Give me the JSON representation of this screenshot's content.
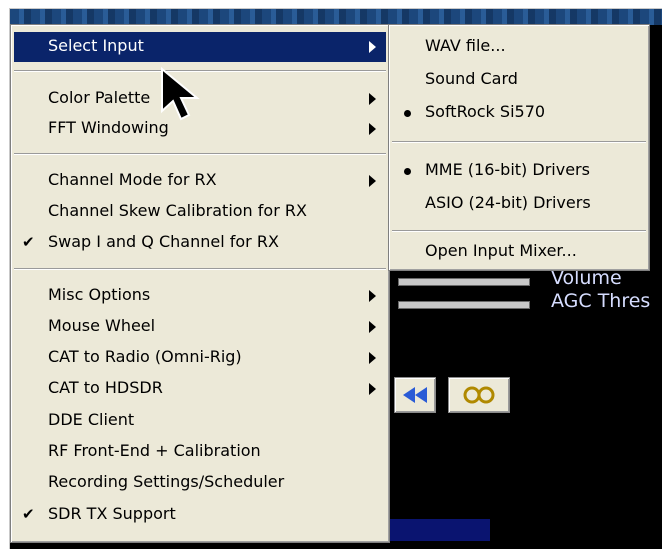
{
  "background": {
    "labels": {
      "volume": "Volume",
      "agc": "AGC Thres"
    }
  },
  "main_menu": {
    "items": [
      {
        "label": "Select Input",
        "has_submenu": true,
        "highlighted": true
      },
      {
        "label": "Color Palette",
        "has_submenu": true
      },
      {
        "label": "FFT Windowing",
        "has_submenu": true
      },
      {
        "label": "Channel Mode for RX",
        "has_submenu": true
      },
      {
        "label": "Channel Skew Calibration for RX"
      },
      {
        "label": "Swap I and Q Channel for RX",
        "checked": true
      },
      {
        "label": "Misc Options",
        "has_submenu": true
      },
      {
        "label": "Mouse Wheel",
        "has_submenu": true
      },
      {
        "label": "CAT to Radio (Omni-Rig)",
        "has_submenu": true
      },
      {
        "label": "CAT to HDSDR",
        "has_submenu": true
      },
      {
        "label": "DDE Client"
      },
      {
        "label": "RF Front-End + Calibration"
      },
      {
        "label": "Recording Settings/Scheduler"
      },
      {
        "label": "SDR TX Support",
        "checked": true
      }
    ]
  },
  "submenu": {
    "items": [
      {
        "label": "WAV file..."
      },
      {
        "label": "Sound Card"
      },
      {
        "label": "SoftRock Si570",
        "selected": true
      },
      {
        "label": "MME  (16-bit) Drivers",
        "selected": true
      },
      {
        "label": "ASIO (24-bit) Drivers"
      },
      {
        "label": "Open Input Mixer..."
      }
    ]
  },
  "glyphs": {
    "check": "✔"
  },
  "colors": {
    "menu_bg": "#ece9d8",
    "highlight": "#0a246a"
  }
}
